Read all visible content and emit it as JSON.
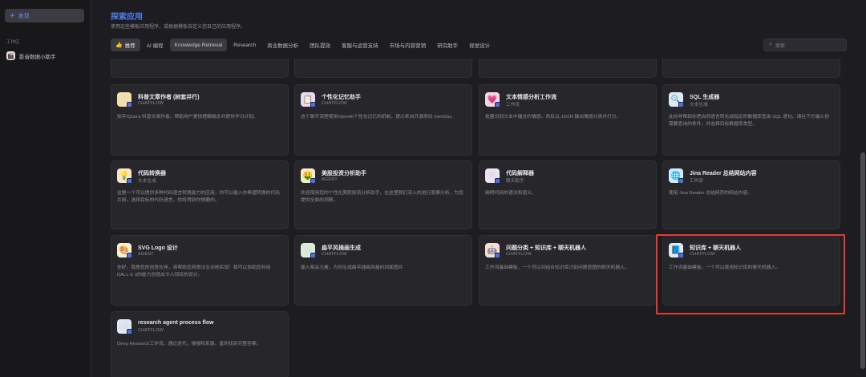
{
  "sidebar": {
    "discover_label": "发现",
    "workspace_label": "工作区",
    "workspace_item": "影音数据小助手"
  },
  "header": {
    "title": "探索应用",
    "subtitle": "使用这些模板应用程序，或根据模板自定义您自己的应用程序。"
  },
  "tabs": [
    {
      "label": "推荐"
    },
    {
      "label": "AI 编程"
    },
    {
      "label": "Knowledge Retrieval"
    },
    {
      "label": "Research"
    },
    {
      "label": "商业数据分析"
    },
    {
      "label": "团队提效"
    },
    {
      "label": "客服与运营支持"
    },
    {
      "label": "市场与内容营销"
    },
    {
      "label": "研究助手"
    },
    {
      "label": "视觉设计"
    }
  ],
  "search": {
    "placeholder": "搜索"
  },
  "cards": [
    {
      "name": "科普文章作者 (树套并行)",
      "kind": "CHATFLOW",
      "desc": "知乎/Quora 科普文章作者。帮助用户更快理解概念并提供学习计划。",
      "icon": "✍",
      "bg": "#f3dfa8"
    },
    {
      "name": "个性化记忆助手",
      "kind": "CHATFLOW",
      "desc": "这个聊天流程使用OpenAI个性化记忆的机制，提示来自开源项目 mem0ai。",
      "icon": "📋",
      "bg": "#ead9f3"
    },
    {
      "name": "文本情感分析工作流",
      "kind": "工作流",
      "desc": "批量识别文本中蕴含的情感，然后以 JSON 输出情感分类并打分。",
      "icon": "💗",
      "bg": "#f4d6e6"
    },
    {
      "name": "SQL 生成器",
      "kind": "文本生成",
      "desc": "此向导帮助你把自然语言转化成指定的数据库查询 SQL 语句。请在下方输入你需要查询的条件，并选择目标数据库类型。",
      "icon": "🔍",
      "bg": "#dbe8f6"
    },
    {
      "name": "代码转换器",
      "kind": "文本生成",
      "desc": "这是一个可以提供多种代码语言转换能力的应用，你可以输入你希望转换的代码片段，选择目标的代码语言，你将得到你想要的。",
      "icon": "💡",
      "bg": "#f6e6c3"
    },
    {
      "name": "美股投资分析助手",
      "kind": "AGENT",
      "desc": "欢迎使用您的个性化美股投资分析助手，在这里我们深入的进行股票分析，为您提供全面的洞察。",
      "icon": "🤑",
      "bg": "#f3ecc8"
    },
    {
      "name": "代码解释器",
      "kind": "聊天助手",
      "desc": "阐明代码的语法和语义。",
      "icon": "👁",
      "bg": "#efe2f4"
    },
    {
      "name": "Jina Reader 总结网站内容",
      "kind": "工作流",
      "desc": "使用 Jina Reader 总结网页的网站内容。",
      "icon": "🌐",
      "bg": "#d6e9f7"
    },
    {
      "name": "SVG Logo 设计",
      "kind": "AGENT",
      "desc": "你好，我是您的创意伙伴，将帮助您将想法生动地实现！我可以协助您利用DALL·E 3的能力创造出令人惊叹的设计。",
      "icon": "🎨",
      "bg": "#f7f0cf"
    },
    {
      "name": "扁平风插画生成",
      "kind": "CHATFLOW",
      "desc": "输入相关元素，为你生成扁平插画风格的封面图片",
      "icon": "🖼",
      "bg": "#d9eed8"
    },
    {
      "name": "问题分类 + 知识库 + 聊天机器人",
      "kind": "CHATFLOW",
      "desc": "工作流基础模板，一个可以对结合知识库识别问题意图的聊天机器人。",
      "icon": "🤖",
      "bg": "#f5dfd3"
    },
    {
      "name": "知识库 + 聊天机器人",
      "kind": "CHATFLOW",
      "desc": "工作流基础模板，一个可以使用知识库的聊天机器人。",
      "icon": "📘",
      "bg": "#dfe9f8"
    },
    {
      "name": "research agent process flow",
      "kind": "CHATFLOW",
      "desc": "Deep Research工作流。通过迭代，搜搜和来源，直到找到完整答案。",
      "icon": "🖼",
      "bg": "#dfe8f6"
    }
  ],
  "colors": {
    "accent": "#4f7df0",
    "highlight": "#e53935"
  }
}
